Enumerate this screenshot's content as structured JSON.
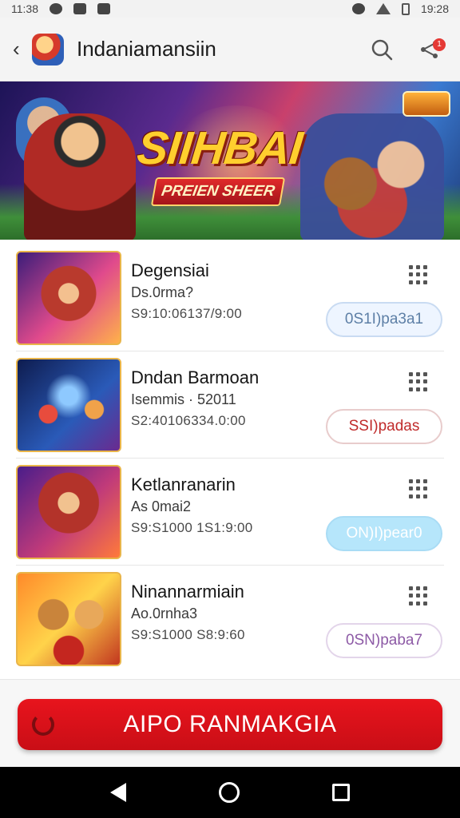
{
  "status_bar": {
    "time_left": "11:38",
    "time_right": "19:28"
  },
  "app_bar": {
    "title": "Indaniamansiin",
    "back_icon": "chevron-left-icon",
    "search_icon": "search-icon",
    "share_icon": "share-icon",
    "notification_count": "1"
  },
  "banner": {
    "title": "SIIHBAI",
    "subtitle": "PREIEN SHEER"
  },
  "games": [
    {
      "name": "Degensiai",
      "subtitle": "Ds.0rma?",
      "meta": "S9:10:06137/9:00",
      "button": "0S1I)pa3a1",
      "button_style": "light-blue"
    },
    {
      "name": "Dndan Barmoan",
      "subtitle": "Isemmis · 52011",
      "meta": "S2:40106334.0:00",
      "button": "SSI)padas",
      "button_style": "red-outline"
    },
    {
      "name": "Ketlanranarin",
      "subtitle": "As 0mai2",
      "meta": "S9:S1000 1S1:9:00",
      "button": "ON)I)pear0",
      "button_style": "cyan-filled"
    },
    {
      "name": "Ninannarmiain",
      "subtitle": "Ao.0rnha3",
      "meta": "S9:S1000 S8:9:60",
      "button": "0SN)paba7",
      "button_style": "purple-outline"
    }
  ],
  "cta": {
    "label": "AIPO RANMAKGIA"
  },
  "colors": {
    "primary_red": "#e8141d",
    "gold": "#ffcf2e"
  }
}
